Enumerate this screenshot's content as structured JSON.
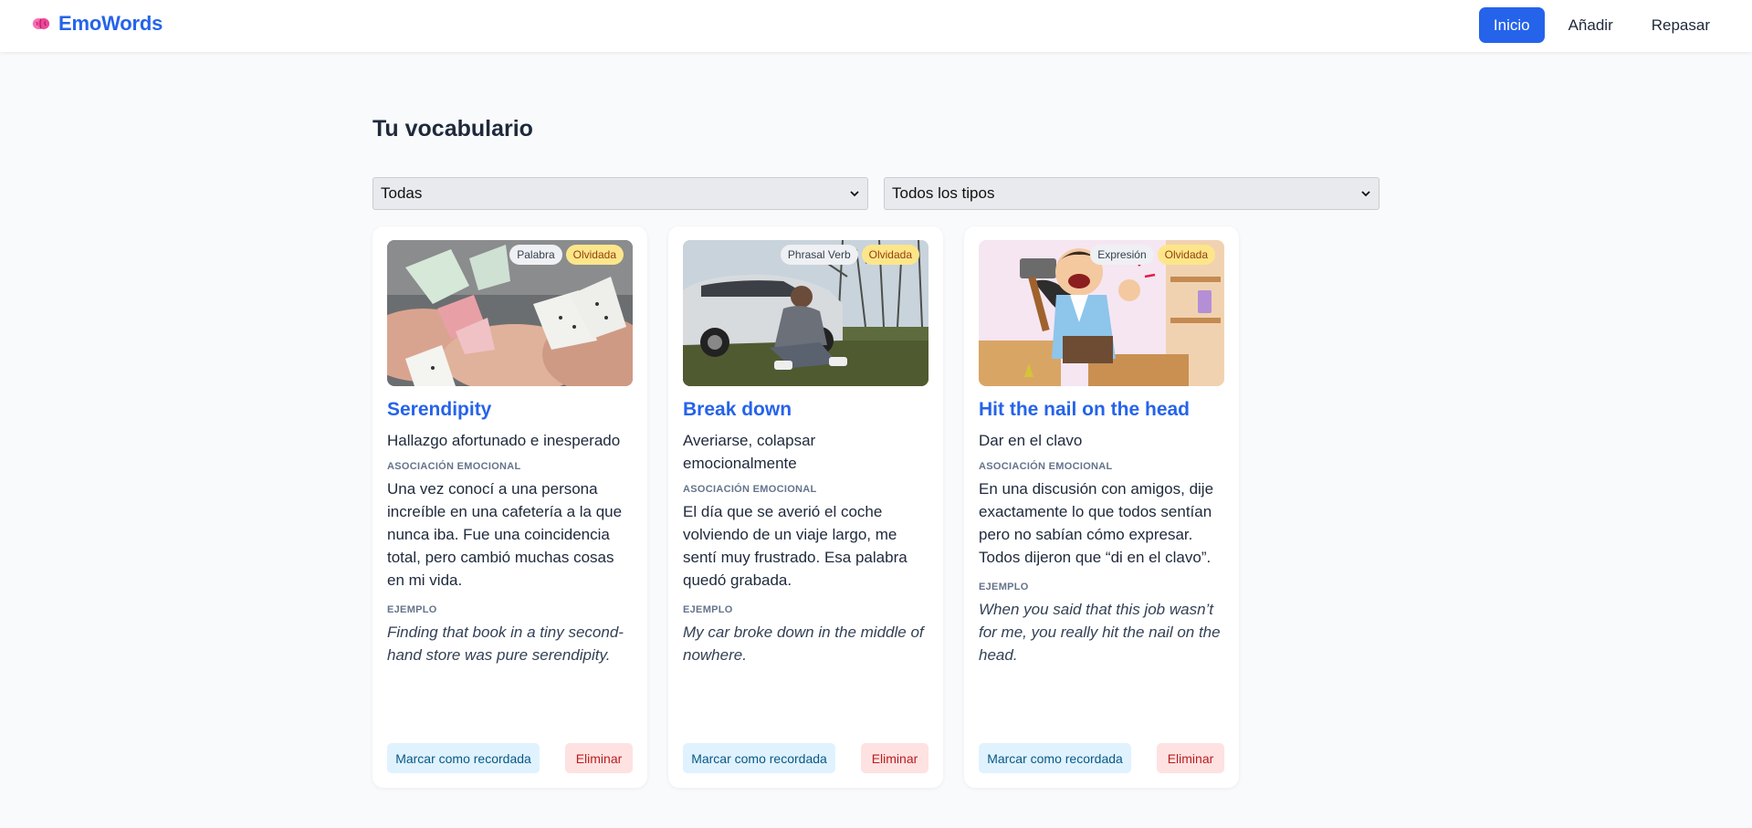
{
  "app": {
    "name": "EmoWords",
    "brand_color": "#2563eb",
    "logo_icon": "brain-icon"
  },
  "nav": {
    "items": [
      {
        "label": "Inicio",
        "active": true
      },
      {
        "label": "Añadir",
        "active": false
      },
      {
        "label": "Repasar",
        "active": false
      }
    ]
  },
  "page": {
    "title": "Tu vocabulario"
  },
  "filters": {
    "status_selected": "Todas",
    "type_selected": "Todos los tipos"
  },
  "labels": {
    "association": "ASOCIACIÓN EMOCIONAL",
    "example": "EJEMPLO"
  },
  "cards": [
    {
      "type": "Palabra",
      "status": "Olvidada",
      "word": "Serendipity",
      "meaning": "Hallazgo afortunado e inesperado",
      "association": "Una vez conocí a una persona increíble en una cafetería a la que nunca iba. Fue una coincidencia total, pero cambió muchas cosas en mi vida.",
      "example": "Finding that book in a tiny second-hand store was pure serendipity.",
      "remember_label": "Marcar como recordada",
      "delete_label": "Eliminar",
      "image": "paper-butterflies-photo"
    },
    {
      "type": "Phrasal Verb",
      "status": "Olvidada",
      "word": "Break down",
      "meaning": "Averiarse, colapsar emocionalmente",
      "association": "El día que se averió el coche volviendo de un viaje largo, me sentí muy frustrado. Esa palabra quedó grabada.",
      "example": "My car broke down in the middle of nowhere.",
      "remember_label": "Marcar como recordada",
      "delete_label": "Eliminar",
      "image": "man-sitting-by-car-photo"
    },
    {
      "type": "Expresión",
      "status": "Olvidada",
      "word": "Hit the nail on the head",
      "meaning": "Dar en el clavo",
      "association": "En una discusión con amigos, dije exactamente lo que todos sentían pero no sabían cómo expresar. Todos dijeron que “di en el clavo”.",
      "example": "When you said that this job wasn’t for me, you really hit the nail on the head.",
      "remember_label": "Marcar como recordada",
      "delete_label": "Eliminar",
      "image": "cartoon-hammer-thumb-illustration"
    }
  ]
}
